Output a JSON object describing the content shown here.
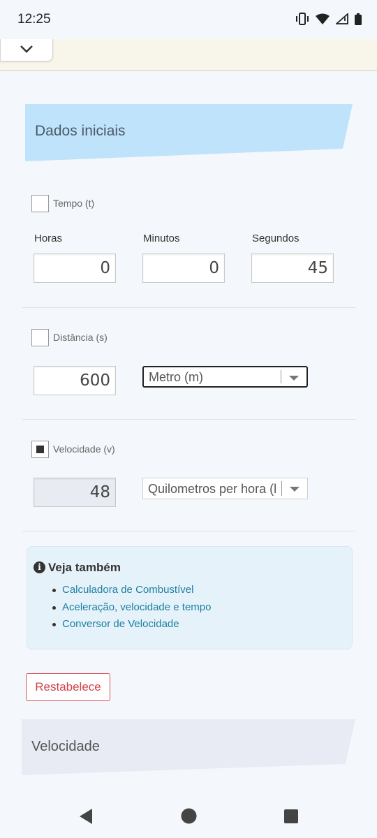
{
  "status_bar": {
    "time": "12:25",
    "icons": [
      "vibrate-icon",
      "wifi-icon",
      "signal-icon",
      "battery-icon"
    ]
  },
  "header": {
    "collapse_icon": "chevron-down-icon"
  },
  "section_title": "Dados iniciais",
  "tempo": {
    "label": "Tempo (t)",
    "checked": false,
    "horas_label": "Horas",
    "minutos_label": "Minutos",
    "segundos_label": "Segundos",
    "horas_value": "0",
    "minutos_value": "0",
    "segundos_value": "45"
  },
  "distancia": {
    "label": "Distância (s)",
    "checked": false,
    "value": "600",
    "unit": "Metro (m)"
  },
  "velocidade": {
    "label": "Velocidade (v)",
    "checked": true,
    "value": "48",
    "unit": "Quilometros per hora (l"
  },
  "see_also": {
    "title": "Veja também",
    "icon": "info-icon",
    "links": [
      "Calculadora de Combustível",
      "Aceleração, velocidade e tempo",
      "Conversor de Velocidade"
    ]
  },
  "reset_label": "Restabelece",
  "result_title": "Velocidade",
  "nav": {
    "back_icon": "back-icon",
    "home_icon": "home-icon",
    "recents_icon": "recents-icon"
  },
  "colors": {
    "banner": "#bfe3fa",
    "link": "#1a7fa0",
    "reset": "#d2424b",
    "info_box": "#e6f2fa"
  }
}
